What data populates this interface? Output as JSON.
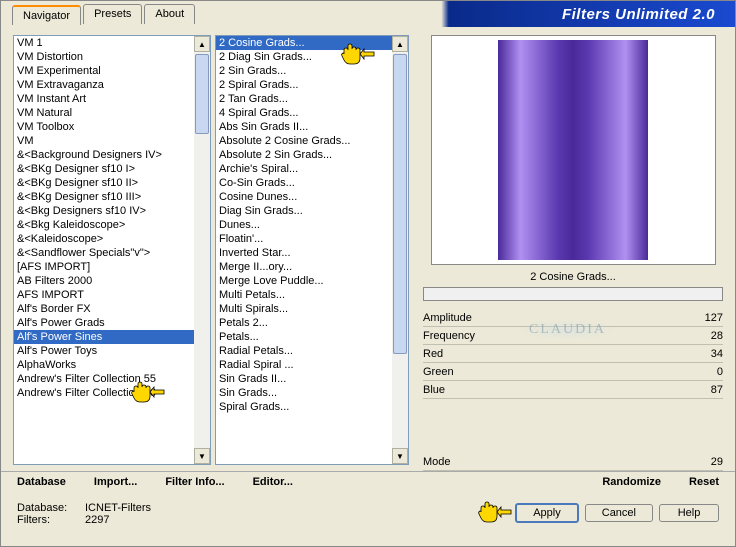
{
  "title": "Filters Unlimited 2.0",
  "tabs": [
    "Navigator",
    "Presets",
    "About"
  ],
  "categories": [
    "VM 1",
    "VM Distortion",
    "VM Experimental",
    "VM Extravaganza",
    "VM Instant Art",
    "VM Natural",
    "VM Toolbox",
    "VM",
    "&<Background Designers IV>",
    "&<BKg Designer sf10 I>",
    "&<BKg Designer sf10 II>",
    "&<BKg Designer sf10 III>",
    "&<Bkg Designers sf10 IV>",
    "&<Bkg Kaleidoscope>",
    "&<Kaleidoscope>",
    "&<Sandflower Specials\"v\">",
    "[AFS IMPORT]",
    "AB Filters 2000",
    "AFS IMPORT",
    "Alf's Border FX",
    "Alf's Power Grads",
    "Alf's Power Sines",
    "Alf's Power Toys",
    "AlphaWorks",
    "Andrew's Filter Collection 55",
    "Andrew's Filter Collection 56"
  ],
  "selected_category_index": 21,
  "filters": [
    "2 Cosine Grads...",
    "2 Diag Sin Grads...",
    "2 Sin Grads...",
    "2 Spiral Grads...",
    "2 Tan Grads...",
    "4 Spiral Grads...",
    "Abs Sin Grads II...",
    "Absolute 2 Cosine Grads...",
    "Absolute 2 Sin Grads...",
    "Archie's Spiral...",
    "Co-Sin Grads...",
    "Cosine Dunes...",
    "Diag Sin Grads...",
    "Dunes...",
    "Floatin'...",
    "Inverted Star...",
    "Merge II...ory...",
    "Merge Love Puddle...",
    "Multi Petals...",
    "Multi Spirals...",
    "Petals 2...",
    "Petals...",
    "Radial Petals...",
    "Radial Spiral ...",
    "Sin Grads II...",
    "Sin Grads...",
    "Spiral Grads..."
  ],
  "selected_filter_index": 0,
  "preview_label": "2 Cosine Grads...",
  "params": [
    {
      "name": "Amplitude",
      "value": 127
    },
    {
      "name": "Frequency",
      "value": 28
    },
    {
      "name": "Red",
      "value": 34
    },
    {
      "name": "Green",
      "value": 0
    },
    {
      "name": "Blue",
      "value": 87
    }
  ],
  "mode": {
    "name": "Mode",
    "value": 29
  },
  "menu": {
    "database": "Database",
    "import": "Import...",
    "filter_info": "Filter Info...",
    "editor": "Editor...",
    "randomize": "Randomize",
    "reset": "Reset"
  },
  "footer": {
    "db_label": "Database:",
    "db_value": "ICNET-Filters",
    "filters_label": "Filters:",
    "filters_value": "2297"
  },
  "buttons": {
    "apply": "Apply",
    "cancel": "Cancel",
    "help": "Help"
  }
}
